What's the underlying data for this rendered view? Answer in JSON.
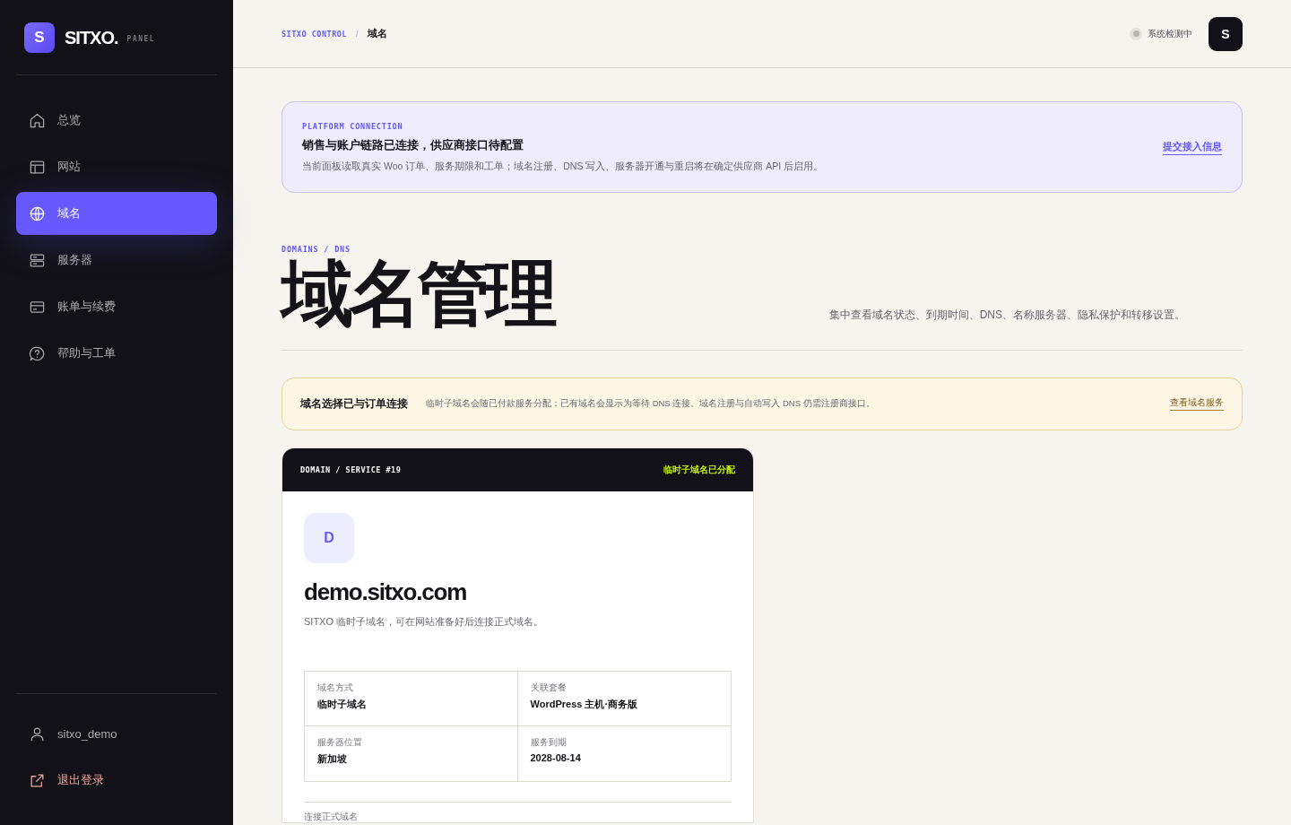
{
  "sidebar": {
    "logo": {
      "letter": "S",
      "name": "SITXO.",
      "tag": "PANEL"
    },
    "items": [
      {
        "label": "总览",
        "selected": false
      },
      {
        "label": "网站",
        "selected": false
      },
      {
        "label": "域名",
        "selected": true
      },
      {
        "label": "服务器",
        "selected": false
      },
      {
        "label": "账单与续费",
        "selected": false
      },
      {
        "label": "帮助与工单",
        "selected": false
      }
    ],
    "user": "sitxo_demo",
    "logout": "退出登录"
  },
  "header": {
    "breadcrumb": [
      "SITXO CONTROL",
      "/",
      "域名"
    ],
    "status": "系统检测中",
    "avatar": "S"
  },
  "notice": {
    "eyebrow": "PLATFORM CONNECTION",
    "title": "销售与账户链路已连接，供应商接口待配置",
    "text": "当前面板读取真实 Woo 订单、服务期限和工单；域名注册、DNS 写入、服务器开通与重启将在确定供应商 API 后启用。",
    "link": "提交接入信息"
  },
  "page": {
    "eyebrow": "DOMAINS / DNS",
    "title": "域名管理",
    "description": "集中查看域名状态、到期时间、DNS、名称服务器、隐私保护和转移设置。"
  },
  "info_banner": {
    "title": "域名选择已与订单连接",
    "text": "临时子域名会随已付款服务分配；已有域名会显示为等待 DNS 连接。域名注册与自动写入 DNS 仍需注册商接口。",
    "link": "查看域名服务"
  },
  "domain_card": {
    "label": "DOMAIN / SERVICE #19",
    "status": "临时子域名已分配",
    "letter": "D",
    "domain": "demo.sitxo.com",
    "description": "SITXO 临时子域名，可在网站准备好后连接正式域名。",
    "fields": [
      {
        "label": "域名方式",
        "value": "临时子域名"
      },
      {
        "label": "关联套餐",
        "value": "WordPress 主机·商务版"
      },
      {
        "label": "服务器位置",
        "value": "新加坡"
      },
      {
        "label": "服务到期",
        "value": "2028-08-14"
      }
    ],
    "section_label": "连接正式域名"
  }
}
